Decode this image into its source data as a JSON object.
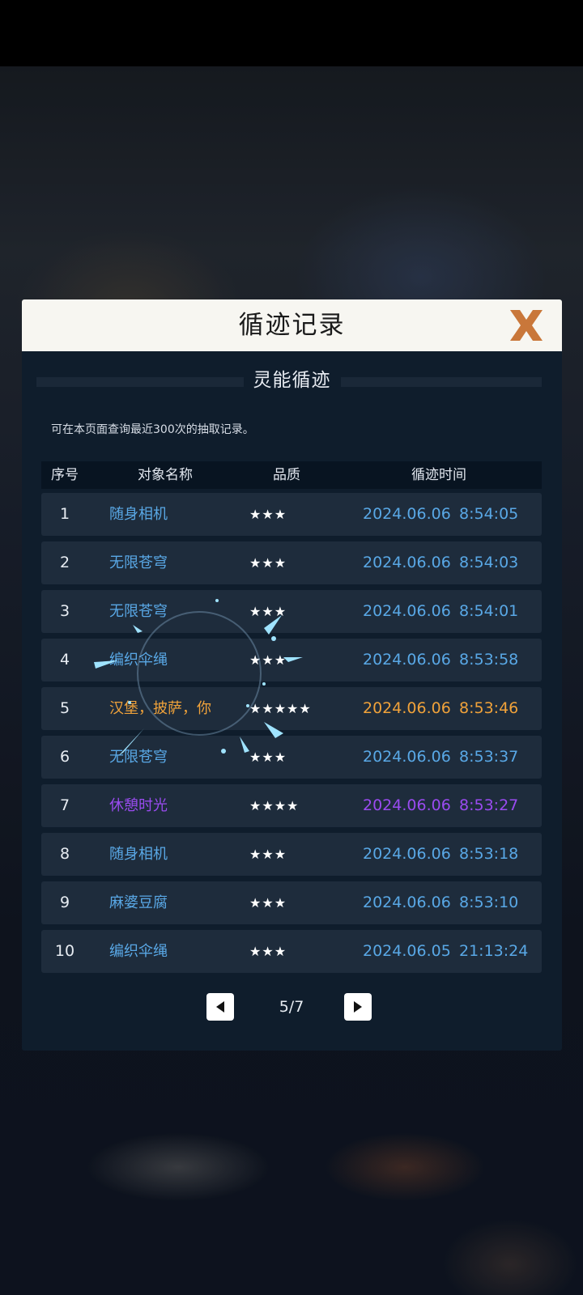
{
  "dialog": {
    "title": "循迹记录",
    "section_title": "灵能循迹",
    "notice": "可在本页面查询最近300次的抽取记录。",
    "close_icon": "close-x-icon"
  },
  "table": {
    "headers": [
      "序号",
      "对象名称",
      "品质",
      "循迹时间"
    ],
    "rows": [
      {
        "idx": "1",
        "name": "随身相机",
        "stars": "★★★",
        "date": "2024.06.06",
        "time": "8:54:05",
        "quality": 3
      },
      {
        "idx": "2",
        "name": "无限苍穹",
        "stars": "★★★",
        "date": "2024.06.06",
        "time": "8:54:03",
        "quality": 3
      },
      {
        "idx": "3",
        "name": "无限苍穹",
        "stars": "★★★",
        "date": "2024.06.06",
        "time": "8:54:01",
        "quality": 3
      },
      {
        "idx": "4",
        "name": "编织伞绳",
        "stars": "★★★",
        "date": "2024.06.06",
        "time": "8:53:58",
        "quality": 3
      },
      {
        "idx": "5",
        "name": "汉堡，披萨，你",
        "stars": "★★★★★",
        "date": "2024.06.06",
        "time": "8:53:46",
        "quality": 5
      },
      {
        "idx": "6",
        "name": "无限苍穹",
        "stars": "★★★",
        "date": "2024.06.06",
        "time": "8:53:37",
        "quality": 3
      },
      {
        "idx": "7",
        "name": "休憩时光",
        "stars": "★★★★",
        "date": "2024.06.06",
        "time": "8:53:27",
        "quality": 4
      },
      {
        "idx": "8",
        "name": "随身相机",
        "stars": "★★★",
        "date": "2024.06.06",
        "time": "8:53:18",
        "quality": 3
      },
      {
        "idx": "9",
        "name": "麻婆豆腐",
        "stars": "★★★",
        "date": "2024.06.06",
        "time": "8:53:10",
        "quality": 3
      },
      {
        "idx": "10",
        "name": "编织伞绳",
        "stars": "★★★",
        "date": "2024.06.05",
        "time": "21:13:24",
        "quality": 3
      }
    ]
  },
  "pager": {
    "label": "5/7",
    "prev_icon": "triangle-left-icon",
    "next_icon": "triangle-right-icon"
  },
  "colors": {
    "quality_3": "#59a8e6",
    "quality_4": "#9a4bf0",
    "quality_5": "#f0a23a",
    "close_icon": "#c9773a",
    "header_bg": "#f7f6f1",
    "panel_bg": "#0f1d2c"
  }
}
